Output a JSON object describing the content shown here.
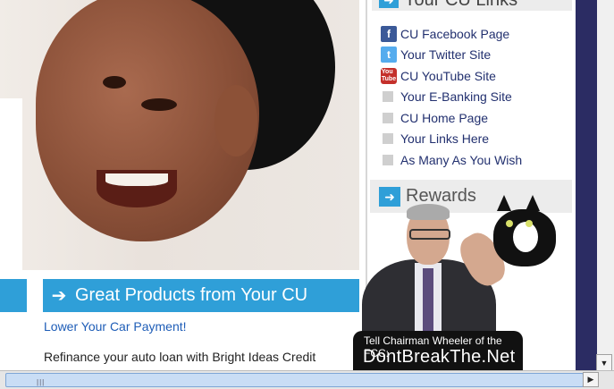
{
  "main": {
    "section_title": "Great Products from Your CU",
    "section_arrow": "➔",
    "promo_link": "Lower Your Car Payment!",
    "promo_text": "Refinance your auto loan with Bright Ideas Credit Union..."
  },
  "sidebar": {
    "top_heading": "Your CU Links",
    "links": [
      {
        "label": "CU Facebook Page",
        "icon": "facebook-icon"
      },
      {
        "label": "Your Twitter Site",
        "icon": "twitter-icon"
      },
      {
        "label": "CU YouTube Site",
        "icon": "youtube-icon"
      },
      {
        "label": "Your E-Banking Site",
        "icon": "bullet-icon"
      },
      {
        "label": "CU Home Page",
        "icon": "bullet-icon"
      },
      {
        "label": "Your Links Here",
        "icon": "bullet-icon"
      },
      {
        "label": "As Many As You Wish",
        "icon": "bullet-icon"
      }
    ],
    "rewards_heading": "Rewards"
  },
  "popup": {
    "line1": "Tell Chairman Wheeler of the FCC:",
    "line2": "DontBreakThe.Net"
  },
  "scroll": {
    "h_right": "▶",
    "v_down": "▼",
    "grip": "|||"
  },
  "colors": {
    "accent": "#2f9fd8",
    "link": "#1e5db7",
    "frame": "#2b2c63"
  }
}
